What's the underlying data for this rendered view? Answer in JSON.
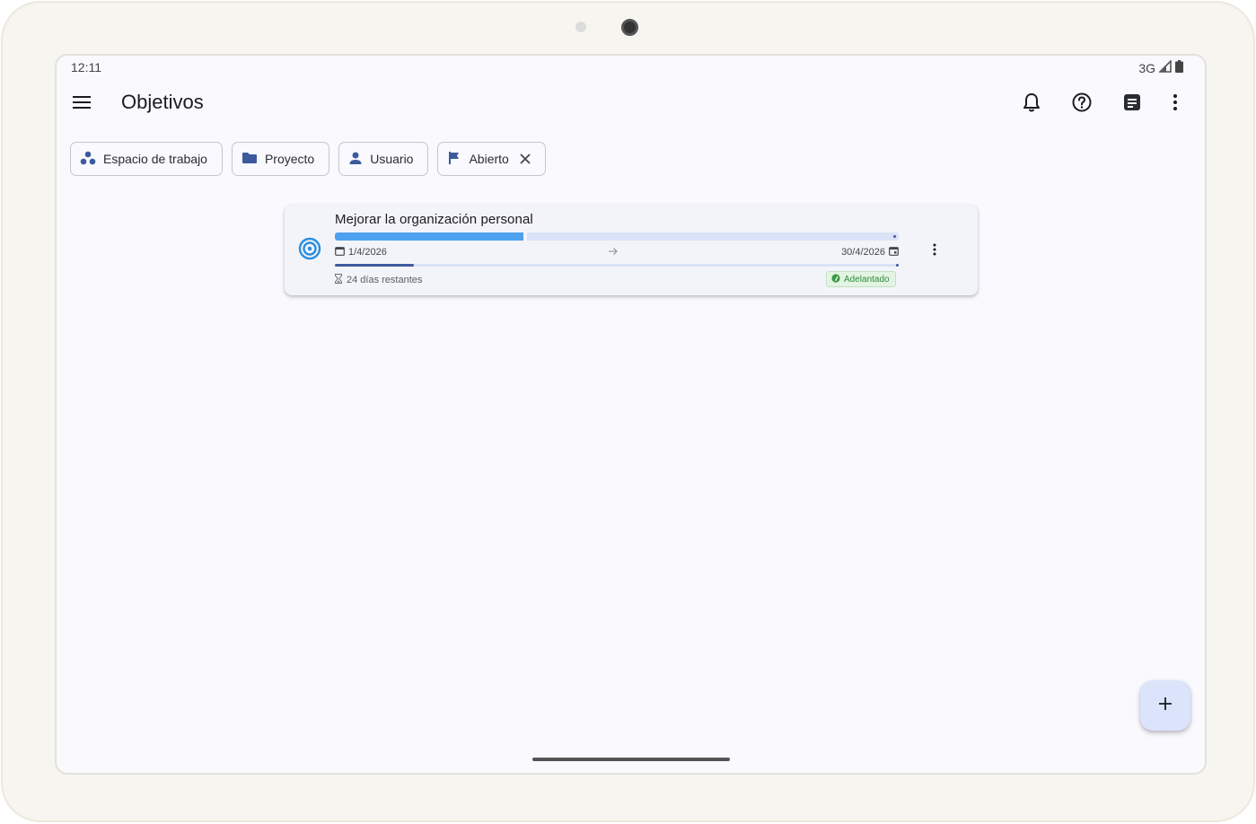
{
  "status_bar": {
    "time": "12:11",
    "network": "3G",
    "icons": [
      "signal-icon",
      "battery-icon"
    ]
  },
  "app_bar": {
    "title": "Objetivos",
    "icons": [
      "menu-icon",
      "bell-icon",
      "help-icon",
      "notes-icon",
      "more-vert-icon"
    ]
  },
  "filters": [
    {
      "label": "Espacio de trabajo",
      "icon": "workspaces-icon"
    },
    {
      "label": "Proyecto",
      "icon": "folder-icon"
    },
    {
      "label": "Usuario",
      "icon": "person-icon"
    },
    {
      "label": "Abierto",
      "icon": "flag-icon",
      "removable": true
    }
  ],
  "goal": {
    "title": "Mejorar la organización personal",
    "progress": 0.335,
    "time_elapsed": 0.14,
    "start_date": "1/4/2026",
    "end_date": "30/4/2026",
    "remaining": "24 días restantes",
    "status": "Adelantado",
    "icon": "target-icon"
  },
  "colors": {
    "accent": "#3d5a9c",
    "progress": "#4da1ee",
    "status_green": "#2e8b3a",
    "fab_bg": "#dbe4fb"
  },
  "fab": {
    "icon": "add-icon"
  }
}
